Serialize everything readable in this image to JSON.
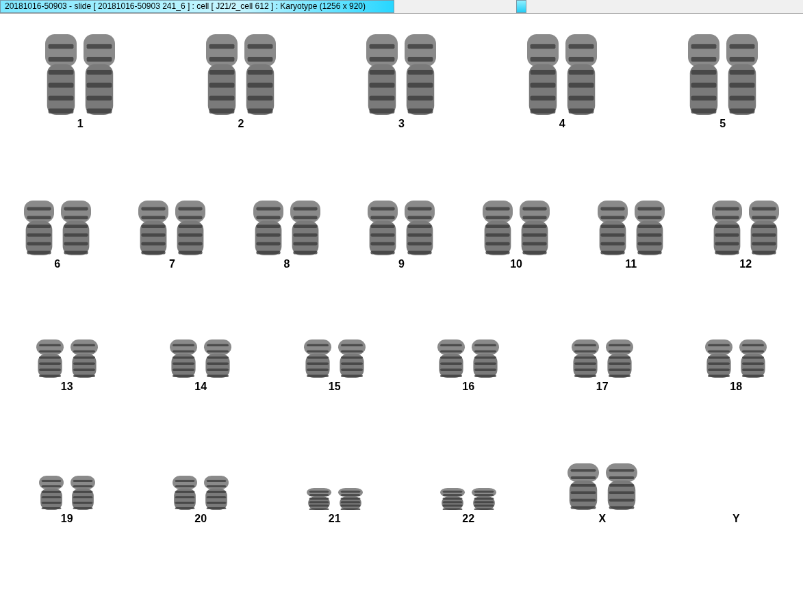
{
  "window": {
    "title": "20181016-50903 - slide [ 20181016-50903 241_6 ] : cell [ J21/2_cell 612 ] : Karyotype  (1256 x 920)"
  },
  "karyotype": {
    "rows": [
      [
        {
          "label": "1",
          "kind": "pair"
        },
        {
          "label": "2",
          "kind": "pair"
        },
        {
          "label": "3",
          "kind": "pair"
        },
        {
          "label": "4",
          "kind": "pair"
        },
        {
          "label": "5",
          "kind": "pair"
        }
      ],
      [
        {
          "label": "6",
          "kind": "pair"
        },
        {
          "label": "7",
          "kind": "pair"
        },
        {
          "label": "8",
          "kind": "pair"
        },
        {
          "label": "9",
          "kind": "pair"
        },
        {
          "label": "10",
          "kind": "pair"
        },
        {
          "label": "11",
          "kind": "pair"
        },
        {
          "label": "12",
          "kind": "pair"
        }
      ],
      [
        {
          "label": "13",
          "kind": "pair"
        },
        {
          "label": "14",
          "kind": "pair"
        },
        {
          "label": "15",
          "kind": "pair"
        },
        {
          "label": "16",
          "kind": "pair"
        },
        {
          "label": "17",
          "kind": "pair"
        },
        {
          "label": "18",
          "kind": "pair"
        }
      ],
      [
        {
          "label": "19",
          "kind": "pair"
        },
        {
          "label": "20",
          "kind": "pair"
        },
        {
          "label": "21",
          "kind": "pair"
        },
        {
          "label": "22",
          "kind": "pair"
        },
        {
          "label": "X",
          "kind": "pair"
        },
        {
          "label": "Y",
          "kind": "empty"
        }
      ]
    ]
  }
}
